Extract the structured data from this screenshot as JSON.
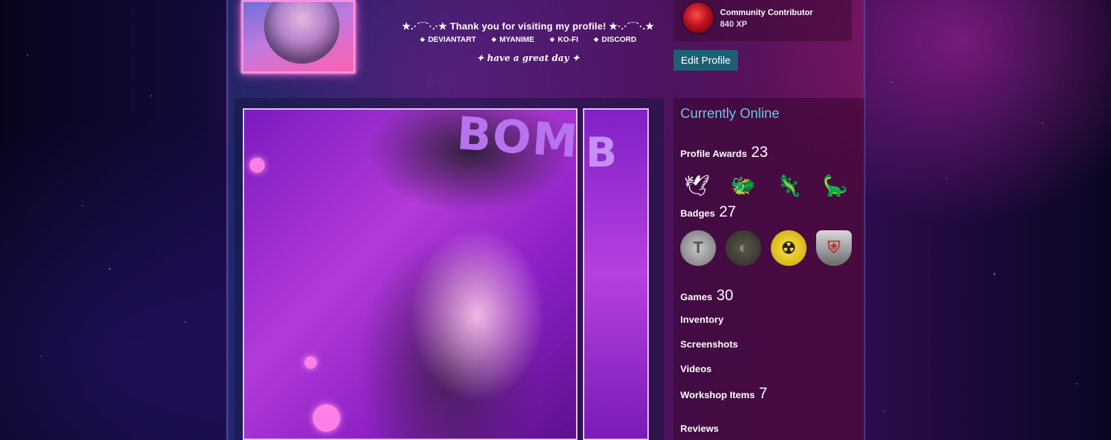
{
  "header": {
    "thanks": "★.·´¯`·.·★ Thank you for visiting my profile! ★·.·´¯`·.★",
    "links": [
      {
        "icon": "❖",
        "label": "DEVIANTART"
      },
      {
        "icon": "❖",
        "label": "MYANIME"
      },
      {
        "icon": "❖",
        "label": "KO-FI"
      },
      {
        "icon": "❖",
        "label": "DISCORD"
      }
    ],
    "great_day": "✦ have a great day ✦"
  },
  "level_badge": {
    "title": "Community Contributor",
    "xp": "840 XP"
  },
  "edit_profile_label": "Edit Profile",
  "showcase": {
    "cap_text": "BOMB",
    "side_text": "B"
  },
  "sidebar": {
    "status": "Currently Online",
    "awards": {
      "label": "Profile Awards",
      "count": "23",
      "icons": [
        "🕊",
        "🐲",
        "🦎",
        "🦕"
      ]
    },
    "badges": {
      "label": "Badges",
      "count": "27",
      "icons": [
        "T",
        "◐",
        "☢",
        "⛨"
      ]
    },
    "games": {
      "label": "Games",
      "count": "30"
    },
    "inventory": {
      "label": "Inventory"
    },
    "screenshots": {
      "label": "Screenshots"
    },
    "videos": {
      "label": "Videos"
    },
    "workshop": {
      "label": "Workshop Items",
      "count": "7"
    },
    "reviews": {
      "label": "Reviews"
    }
  },
  "colors": {
    "accent_online": "#6ac6e6",
    "edit_button": "#1e6073",
    "frame_glow": "#ff8fe0"
  }
}
